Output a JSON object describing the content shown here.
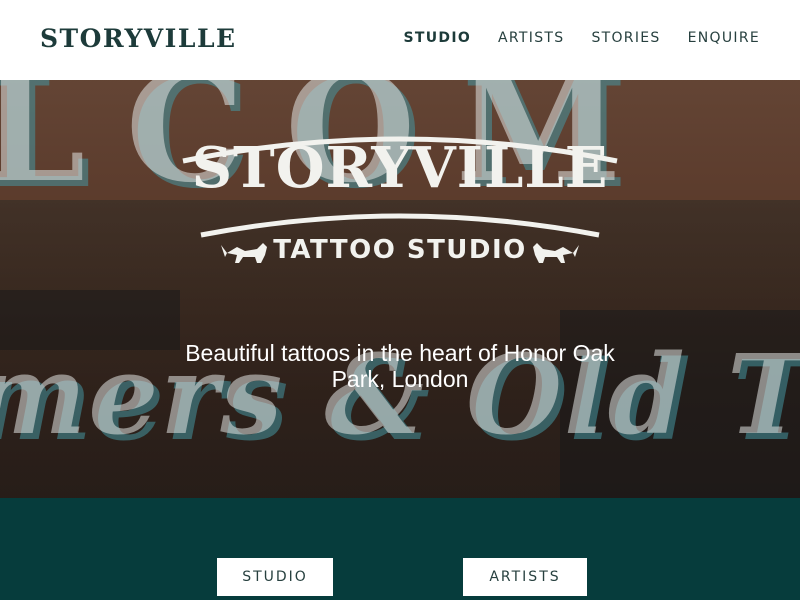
{
  "header": {
    "logo_text": "STORYVILLE",
    "nav": [
      {
        "label": "STUDIO",
        "active": true
      },
      {
        "label": "ARTISTS",
        "active": false
      },
      {
        "label": "STORIES",
        "active": false
      },
      {
        "label": "ENQUIRE",
        "active": false
      }
    ]
  },
  "hero": {
    "brand": "STORYVILLE",
    "subtitle": "TATTOO STUDIO",
    "tagline": "Beautiful tattoos in the heart of Honor Oak Park, London",
    "icons": [
      "fox-icon",
      "fox-icon"
    ]
  },
  "band": {
    "buttons": [
      {
        "label": "STUDIO"
      },
      {
        "label": "ARTISTS"
      }
    ]
  },
  "colors": {
    "brand_dark": "#1d3b3a",
    "band_teal": "#063c3c",
    "logo_white": "#f2f2ee"
  }
}
